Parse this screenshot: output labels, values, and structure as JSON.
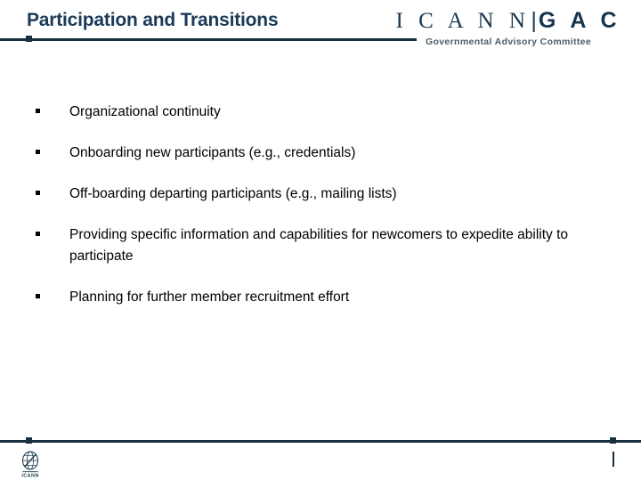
{
  "slide": {
    "title": "Participation and Transitions",
    "logo": {
      "icann": "I C A N N",
      "separator": "|",
      "gac": "G A C",
      "subtitle": "Governmental Advisory Committee"
    },
    "bullets": [
      {
        "text": "Organizational continuity"
      },
      {
        "text": "Onboarding new participants (e.g., credentials)"
      },
      {
        "text": "Off-boarding departing participants (e.g., mailing lists)"
      },
      {
        "text": "Providing specific information and capabilities for newcomers to expedite ability to participate"
      },
      {
        "text": "Planning for further member recruitment effort"
      }
    ],
    "footer": {
      "logo_text": "ICANN"
    },
    "colors": {
      "brand_navy": "#1b3a57",
      "rule": "#17313f",
      "body_text": "#000000",
      "background": "#ffffff",
      "logo_subtitle": "#4b5d6b"
    }
  }
}
